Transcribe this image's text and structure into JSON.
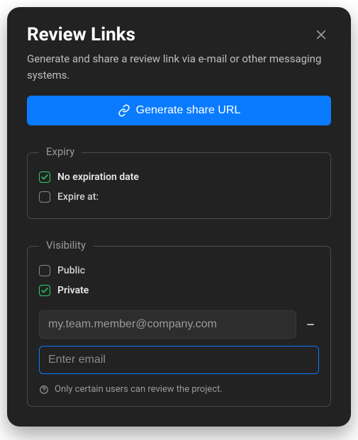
{
  "header": {
    "title": "Review Links",
    "description": "Generate and share a review link via e-mail or other messaging systems."
  },
  "buttons": {
    "generate": "Generate share URL"
  },
  "expiry": {
    "legend": "Expiry",
    "options": {
      "none": "No expiration date",
      "at": "Expire at:"
    },
    "selected": "none"
  },
  "visibility": {
    "legend": "Visibility",
    "options": {
      "public": "Public",
      "private": "Private"
    },
    "selected": "private",
    "emails": [
      {
        "value": "my.team.member@company.com"
      }
    ],
    "new_email_placeholder": "Enter email",
    "help": "Only certain users can review the project."
  }
}
